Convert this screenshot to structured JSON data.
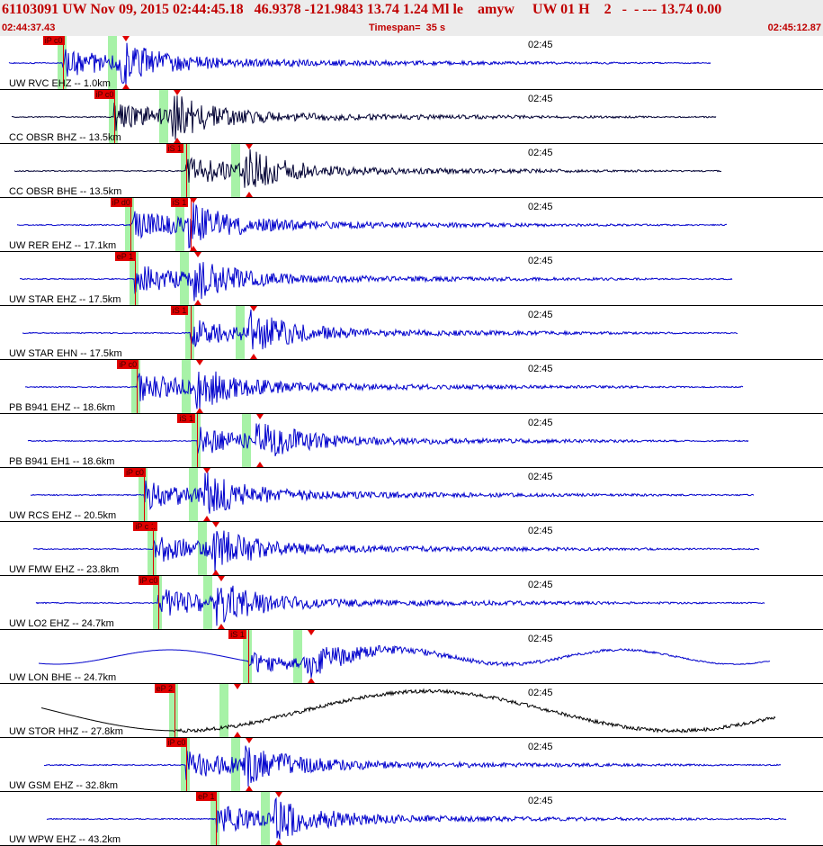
{
  "header": {
    "title": "61103091 UW Nov 09, 2015 02:44:45.18   46.9378 -121.9843 13.74 1.24 Ml le    amyw     UW 01 H    2   -  - --- 13.74 0.00",
    "start_time": "02:44:37.43",
    "timespan": "Timespan=  35 s",
    "end_time": "02:45:12.87"
  },
  "colors": {
    "trace_blue": "#0000cc",
    "trace_black": "#000000",
    "pick_red": "#e00000",
    "window_green": "#a7f2a7",
    "header_red": "#c00000"
  },
  "traces": [
    {
      "station": "UW RVC EHZ -- 1.0km",
      "time_mark": "02:45",
      "color": "#0000cc",
      "picks": [
        {
          "label": "iP c0",
          "t": 2.7
        }
      ]
    },
    {
      "station": "CC OBSR BHZ -- 13.5km",
      "time_mark": "02:45",
      "color": "#000033",
      "picks": [
        {
          "label": "iP c0",
          "t": 4.9
        }
      ]
    },
    {
      "station": "CC OBSR BHE -- 13.5km",
      "time_mark": "02:45",
      "color": "#000033",
      "picks": [
        {
          "label": "iS 1",
          "t": 8.0
        }
      ]
    },
    {
      "station": "UW RER EHZ -- 17.1km",
      "time_mark": "02:45",
      "color": "#0000cc",
      "picks": [
        {
          "label": "iP d0",
          "t": 5.6
        },
        {
          "label": "iS 1",
          "t": 8.2
        }
      ]
    },
    {
      "station": "UW STAR EHZ -- 17.5km",
      "time_mark": "02:45",
      "color": "#0000cc",
      "picks": [
        {
          "label": "eP 1",
          "t": 5.8
        }
      ]
    },
    {
      "station": "UW STAR EHN -- 17.5km",
      "time_mark": "02:45",
      "color": "#0000cc",
      "picks": [
        {
          "label": "iS 1",
          "t": 8.2
        }
      ]
    },
    {
      "station": "PB B941 EHZ -- 18.6km",
      "time_mark": "02:45",
      "color": "#0000cc",
      "picks": [
        {
          "label": "iP c0",
          "t": 5.9
        }
      ]
    },
    {
      "station": "PB B941 EH1 -- 18.6km",
      "time_mark": "02:45",
      "color": "#0000cc",
      "picks": [
        {
          "label": "iS 1",
          "t": 8.5
        }
      ]
    },
    {
      "station": "UW RCS EHZ -- 20.5km",
      "time_mark": "02:45",
      "color": "#0000cc",
      "picks": [
        {
          "label": "iP c0",
          "t": 6.2
        }
      ]
    },
    {
      "station": "UW FMW EHZ -- 23.8km",
      "time_mark": "02:45",
      "color": "#0000cc",
      "picks": [
        {
          "label": "iP c 1",
          "t": 6.6
        }
      ]
    },
    {
      "station": "UW LO2 EHZ -- 24.7km",
      "time_mark": "02:45",
      "color": "#0000cc",
      "picks": [
        {
          "label": "iP c0",
          "t": 6.8
        }
      ]
    },
    {
      "station": "UW LON BHE -- 24.7km",
      "time_mark": "02:45",
      "color": "#0000cc",
      "picks": [
        {
          "label": "iS 1",
          "t": 10.7
        }
      ]
    },
    {
      "station": "UW STOR HHZ -- 27.8km",
      "time_mark": "02:45",
      "color": "#000000",
      "picks": [
        {
          "label": "eP 2",
          "t": 7.5
        }
      ]
    },
    {
      "station": "UW GSM EHZ -- 32.8km",
      "time_mark": "02:45",
      "color": "#0000cc",
      "picks": [
        {
          "label": "iP c0",
          "t": 8.0
        }
      ]
    },
    {
      "station": "UW WPW EHZ -- 43.2km",
      "time_mark": "02:45",
      "color": "#0000cc",
      "picks": [
        {
          "label": "eP 1",
          "t": 9.3
        }
      ]
    }
  ]
}
